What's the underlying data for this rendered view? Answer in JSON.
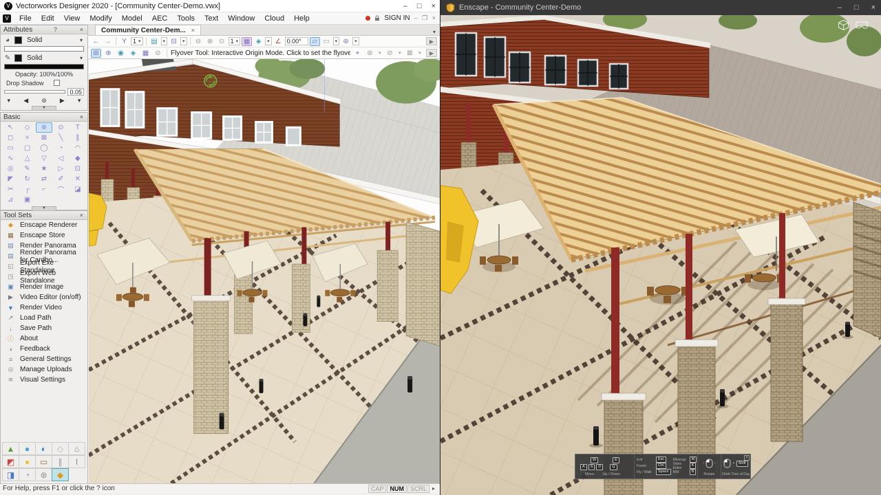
{
  "colors": {
    "siding": "#7d4226",
    "siding_dark": "#5c2f18",
    "sidingR": "#8a3a22",
    "sidingR_dark": "#61250f",
    "roof": "#d9d7d2",
    "roof_seam": "#c8c6c1",
    "roofR": "#b2a89e",
    "roofR_seam": "#a29991",
    "pergola_light": "#ead09e",
    "pergola_dark": "#c79e63",
    "pergolaR_light": "#edd096",
    "pergolaR_dark": "#bb8c4e",
    "stone": "#cfc3a6",
    "stone_line": "#9f8f6e",
    "stoneR": "#b3a183",
    "stoneR_line": "#7e6c50",
    "patio": "#e6dcc7",
    "patioR": "#d9cbb1",
    "tile_line": "#cfc2a8",
    "tileR_line": "#c2b295",
    "band": "#44342a",
    "sidewalk": "#b5b4ad",
    "sidewalkR": "#a7a29a",
    "post": "#7c2220",
    "postR": "#8e2b26",
    "umbrella": "#efe9d6",
    "umbrellaR": "#f2ecd9",
    "wood": "#9a6a33",
    "wood_dark": "#6b4722",
    "tree": "#86a164",
    "treeR": "#7c9754",
    "excavator": "#f1c32a",
    "fascia": "#f6f5f2",
    "fasciaR": "#efece6",
    "glass": "#cdd2d4",
    "glassR": "#232a2e",
    "accent_green": "#7cb342"
  },
  "vectorworks": {
    "title": "Vectorworks Designer 2020 - [Community Center-Demo.vwx]",
    "window": {
      "min": "–",
      "max": "□",
      "close": "×"
    },
    "menu": [
      "File",
      "Edit",
      "View",
      "Modify",
      "Model",
      "AEC",
      "Tools",
      "Text",
      "Window",
      "Cloud",
      "Help"
    ],
    "account": {
      "sign_in": "SIGN IN"
    },
    "doc_controls": {
      "min": "–",
      "restore": "❐",
      "close": "×"
    },
    "tab": {
      "label": "Community Center-Dem...",
      "close": "×"
    },
    "view_bar": {
      "view_number": "1",
      "zoom_level": "1",
      "angle": "0.00°"
    },
    "mode_hint": "Flyover Tool: Interactive Origin Mode. Click to set the flyover origin or c",
    "attributes": {
      "title": "Attributes",
      "help": "?",
      "close": "×",
      "fill_style": "Solid",
      "pen_style": "Solid",
      "opacity_label": "Opacity: 100%/100%",
      "drop_shadow_label": "Drop Shadow",
      "line_weight": "0.05"
    },
    "basic": {
      "title": "Basic",
      "close": "×"
    },
    "tool_sets": {
      "title": "Tool Sets",
      "close": "×",
      "items": [
        "Enscape Renderer",
        "Enscape Store",
        "Render Panorama",
        "Render Panorama for Cardbo...",
        "Export Exe Standalone",
        "Export Web Standalone",
        "Render Image",
        "Video Editor (on/off)",
        "Render Video",
        "Load Path",
        "Save Path",
        "About",
        "Feedback",
        "General Settings",
        "Manage Uploads",
        "Visual Settings"
      ]
    },
    "status": {
      "help": "For Help, press F1 or click the ? icon",
      "cap": "CAP",
      "num": "NUM",
      "scrl": "SCRL",
      "more": "▸"
    }
  },
  "enscape": {
    "title": "Enscape - Community Center-Demo",
    "window": {
      "min": "–",
      "max": "□",
      "close": "×"
    },
    "overlay": {
      "close": "×",
      "key_w": "W",
      "key_a": "A",
      "key_s": "S",
      "key_d": "D",
      "key_e": "E",
      "key_q": "Q",
      "move_label": "Move",
      "updown_label": "Up / Down",
      "exit_label": "Exit",
      "exit_key": "Esc",
      "faster_label": "Faster",
      "faster_key": "Ctrl",
      "fly_label": "Fly / Walk",
      "fly_key": "Space",
      "minimap_label": "Minimap",
      "minimap_key": "M",
      "video_label": "Video Editor",
      "video_key": "K",
      "bim_label": "BIM",
      "bim_key": "B",
      "rotate_label": "Rotate",
      "orbit_label": "Orbit",
      "plus": "+",
      "shift_key": "Shift",
      "time_label": "Time of Day"
    }
  }
}
